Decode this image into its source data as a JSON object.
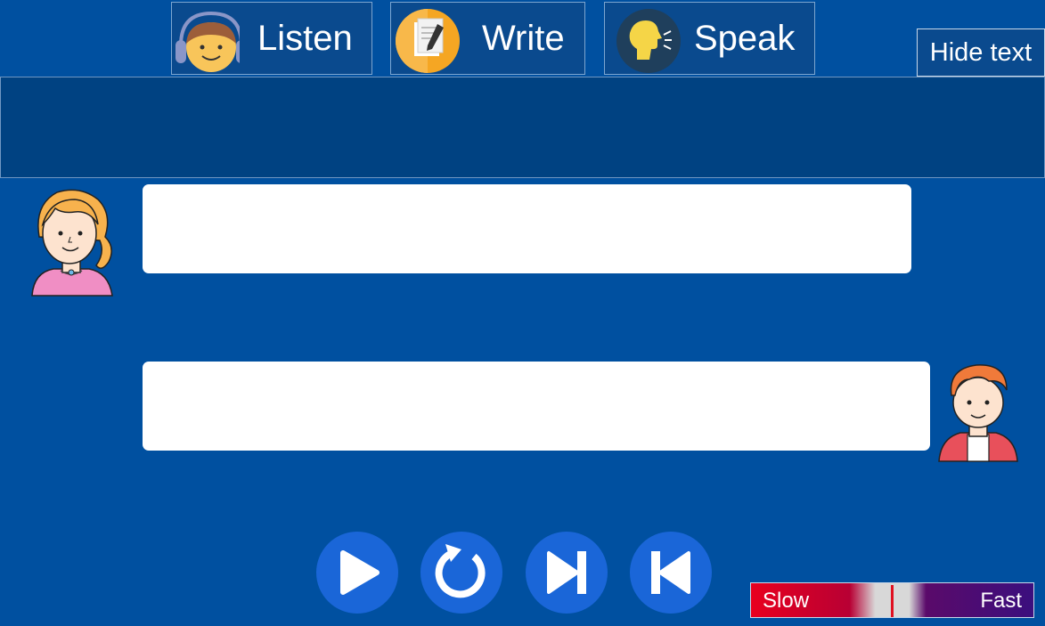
{
  "tabs": {
    "listen": {
      "label": "Listen",
      "icon": "headphones-face-icon"
    },
    "write": {
      "label": "Write",
      "icon": "notepad-pencil-icon"
    },
    "speak": {
      "label": "Speak",
      "icon": "speaking-head-icon"
    }
  },
  "hide_text": {
    "label": "Hide text"
  },
  "dialogue": {
    "line_1": {
      "speaker": "girl-avatar",
      "text": ""
    },
    "line_2": {
      "speaker": "boy-avatar",
      "text": ""
    }
  },
  "controls": {
    "play": {
      "icon": "play-icon"
    },
    "replay": {
      "icon": "replay-icon"
    },
    "next": {
      "icon": "skip-next-icon"
    },
    "previous": {
      "icon": "skip-previous-icon"
    }
  },
  "speed": {
    "slow_label": "Slow",
    "fast_label": "Fast",
    "level": 0.5
  },
  "colors": {
    "background": "#0050a0",
    "control": "#1a66d8",
    "slow": "#e8001e",
    "fast": "#3b0f7e"
  }
}
